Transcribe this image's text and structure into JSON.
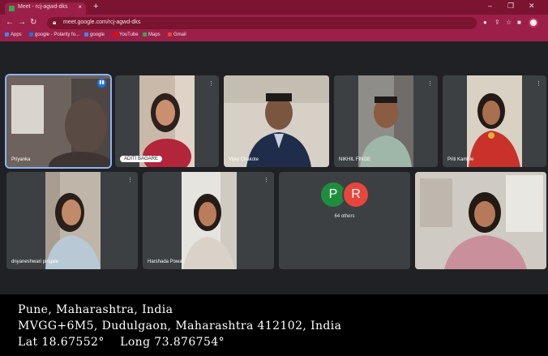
{
  "browser": {
    "tab_title": "Meet - rcj-agwd-dks",
    "tab_close": "×",
    "new_tab": "+",
    "url": "meet.google.com/rcj-agwd-dks",
    "window_minimize": "–",
    "window_restore": "❐",
    "window_close": "✕",
    "theme_color": "#9b1f48"
  },
  "bookmarks": [
    {
      "label": "Apps",
      "color": "#4285f4"
    },
    {
      "label": "google - Polarity fo...",
      "color": "#1a73e8"
    },
    {
      "label": "google",
      "color": "#4285f4"
    },
    {
      "label": "YouTube",
      "color": "#ff0000"
    },
    {
      "label": "Maps",
      "color": "#34a853"
    },
    {
      "label": "Gmail",
      "color": "#ea4335"
    }
  ],
  "meet": {
    "participants": [
      {
        "name": "Priyanka"
      },
      {
        "name": "ADITI BAGARE"
      },
      {
        "name": "Vijay Chakote"
      },
      {
        "name": "NIKHIL FINGE"
      },
      {
        "name": "Priti Kamble"
      },
      {
        "name": "dnyaneshwari pingale"
      },
      {
        "name": "Harshada Powar"
      },
      {
        "name": ""
      }
    ],
    "others_tile": {
      "avatar_1": "P",
      "avatar_2": "R",
      "label": "64 others"
    },
    "accent": "#8ab4f8"
  },
  "geotag": {
    "line1": "Pune, Maharashtra, India",
    "line2": "MVGG+6M5, Dudulgaon, Maharashtra 412102, India",
    "line3": "Lat 18.67552°    Long 73.876754°"
  }
}
